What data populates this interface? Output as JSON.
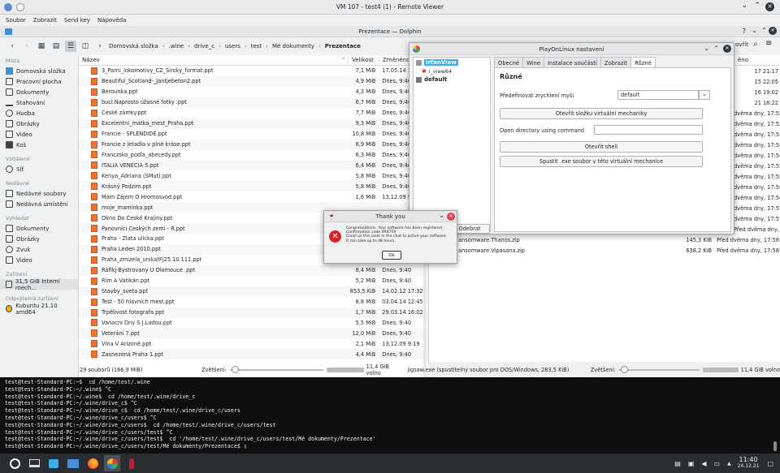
{
  "remote_viewer": {
    "title": "VM 107 - test4 (1) - Remote Viewer",
    "menu": [
      "Soubor",
      "Zobrazit",
      "Send key",
      "Nápověda"
    ]
  },
  "dolphin": {
    "title": "Prezentace — Dolphin",
    "breadcrumbs": [
      "Domovská složka",
      ".wine",
      "drive_c",
      "users",
      "test",
      "Mé dokumenty",
      "Prezentace"
    ],
    "sidebar": {
      "places_title": "Místa",
      "places": [
        "Domovská složka",
        "Pracovní plocha",
        "Dokumenty",
        "Stahování",
        "Hudba",
        "Obrázky",
        "Video",
        "Koš"
      ],
      "remote_title": "Vzdálené",
      "remote": [
        "Síť"
      ],
      "recent_title": "Nedávné",
      "recent": [
        "Nedávné soubory",
        "Nedávná umístění"
      ],
      "search_title": "Vyhledat",
      "search": [
        "Dokumenty",
        "Obrázky",
        "Zvuk",
        "Video"
      ],
      "devices_title": "Zařízení",
      "devices": [
        "31,5 GiB Interní mech..."
      ],
      "removable_title": "Odpojitelná zařízení",
      "removable": [
        "Kubuntu 21.10 amd64"
      ]
    },
    "columns": {
      "name": "Název",
      "size": "Velikost",
      "modified": "Změněno"
    },
    "files": [
      {
        "name": "3_Parni_lokomotivy_CZ_Siroky_format.ppt",
        "size": "7,1 MiB",
        "date": "17.05.14 17:21"
      },
      {
        "name": "Beautiful_Scotland-_Jantjebeton2.ppt",
        "size": "4,9 MiB",
        "date": "Dnes, 9:40"
      },
      {
        "name": "Berounka.ppt",
        "size": "4,3 MiB",
        "date": "Dnes, 9:40"
      },
      {
        "name": "bucl.Naprosto úžasné fotky .ppt",
        "size": "6,7 MiB",
        "date": "Dnes, 9:40"
      },
      {
        "name": "Ceské zámky.ppt",
        "size": "7,7 MiB",
        "date": "Dnes, 9:40"
      },
      {
        "name": "Excelentni_matka_mest_Praha.ppt",
        "size": "9,3 MiB",
        "date": "Dnes, 9:40"
      },
      {
        "name": "Francie - SPLENDIDE.ppt",
        "size": "10,8 MiB",
        "date": "Dnes, 9:40"
      },
      {
        "name": "Francie z letadla v plné kráse.ppt",
        "size": "6,9 MiB",
        "date": "Dnes, 9:40"
      },
      {
        "name": "Franczsko_podla_abecedy.ppt",
        "size": "6,3 MiB",
        "date": "Dnes, 9:40"
      },
      {
        "name": "ITALIA VENECIA 5.ppt",
        "size": "6,4 MiB",
        "date": "Dnes, 9:40"
      },
      {
        "name": "Kenya_Adriana (SMut).ppt",
        "size": "5,8 MiB",
        "date": "Dnes, 9:40"
      },
      {
        "name": "Krásný Podzim.ppt",
        "size": "5,8 MiB",
        "date": "Dnes, 9:40"
      },
      {
        "name": "Mám Zájem O Hromosvod.ppt",
        "size": "1,6 MiB",
        "date": "13.12.09 9:19"
      },
      {
        "name": "moje_maminka.ppt",
        "size": "",
        "date": ""
      },
      {
        "name": "Okno Do České Krajiny.ppt",
        "size": "",
        "date": ""
      },
      {
        "name": "Panovníci Ceských zemi - R.ppt",
        "size": "",
        "date": ""
      },
      {
        "name": "Praha - Zlata ulicka.ppt",
        "size": "",
        "date": ""
      },
      {
        "name": "Praha Leden 2010.ppt",
        "size": "",
        "date": ""
      },
      {
        "name": "Praha_zmizela_unikatFj25.10.111.ppt",
        "size": "",
        "date": ""
      },
      {
        "name": "Ráflkj-Bystrovany U Olomouce .ppt",
        "size": "8,4 MiB",
        "date": "Dnes, 9:40"
      },
      {
        "name": "Řím A Vatikán.ppt",
        "size": "5,2 MiB",
        "date": "Dnes, 9:40"
      },
      {
        "name": "Stavby_sveta.ppt",
        "size": "853,5 KiB",
        "date": "14.02.12 17:32"
      },
      {
        "name": "Test - 50 hlavních mest.ppt",
        "size": "8,8 MiB",
        "date": "03.04.14 12:45"
      },
      {
        "name": "Trpělivost fotografa.ppt",
        "size": "1,7 MiB",
        "date": "29.03.14 16:02"
      },
      {
        "name": "Vanocni Dny S J.Ladou.ppt",
        "size": "5,5 MiB",
        "date": "Dnes, 9:40"
      },
      {
        "name": "Veterání 7.ppt",
        "size": "12,0 MiB",
        "date": "Dnes, 9:40"
      },
      {
        "name": "Vlna V Arizoně.ppt",
        "size": "2,1 MiB",
        "date": "13.12.09 9:19"
      },
      {
        "name": "Zasnezená Praha 1.ppt",
        "size": "4,4 MiB",
        "date": "Dnes, 9:40"
      }
    ],
    "right_pane": {
      "col_date": "ěno",
      "top_dates": [
        "17 21:17",
        "15 22:05",
        "16 19:02",
        "21 18:22",
        "dvěma dny, 17:53",
        "dvěma dny, 17:53",
        "dvěma dny, 17:54",
        "dvěma dny, 17:54",
        "dvěma dny, 17:54",
        "dvěma dny, 17:55",
        "dvěma dny, 17:55",
        "dvěma dny, 17:56",
        "dvěma dny, 17:56",
        "dvěma dny, 17:57",
        "dvěma dny, 17:57",
        "Před dvěma dny, 17:58"
      ],
      "files": [
        {
          "name": "ansomware.Thanos.zip",
          "size": "145,3 KiB",
          "date": "Před dvěma dny, 17:58"
        },
        {
          "name": "ansomware.Vipasana.zip",
          "size": "638,2 KiB",
          "date": "Před dvěma dny, 17:58"
        }
      ]
    },
    "status_left": {
      "count": "29 souborů (166,9 MiB)",
      "zoom_label": "Zvětšení:",
      "free": "11,4 GiB volno"
    },
    "status_mid": "jigsaw.exe (spustitelný soubor pro DOS/Windows, 283,5 KiB)",
    "status_right": {
      "zoom_label": "Zvětšení:",
      "free": "11,4 GiB volno"
    }
  },
  "pol": {
    "title": "PlayOnLinux nastavení",
    "list": [
      "IrfanView",
      "i_view64",
      "default"
    ],
    "tabs": [
      "Obecné",
      "Wine",
      "Instalace součástí",
      "Zobrazit",
      "Různé"
    ],
    "heading": "Různé",
    "mouse_label": "Předefinovat zrychlení myši",
    "mouse_value": "default",
    "btn_open_folder": "Otevřít složku virtuální mechaniky",
    "open_dir_label": "Open directory using command",
    "btn_shell": "Otevřít shell",
    "btn_exe": "Spustit .exe soubor v této virtuální mechanice",
    "btn_remove": "Odebrat"
  },
  "thank_you": {
    "title": "Thank you",
    "lines": [
      "Congratulations. Your software has been registered.",
      "Confirmation code 994759",
      "Email us this code in the chat to active your software.",
      "It can take up to 48 hours."
    ],
    "ok": "Ok"
  },
  "terminal": [
    "test@test-Standard-PC:~$  cd /home/test/.wine",
    "test@test-Standard-PC:~/.wine$ ^C",
    "test@test-Standard-PC:~/.wine$  cd /home/test/.wine/drive_c",
    "test@test-Standard-PC:~/.wine/drive_c$ ^C",
    "test@test-Standard-PC:~/.wine/drive_c$  cd /home/test/.wine/drive_c/users",
    "test@test-Standard-PC:~/.wine/drive_c/users$ ^C",
    "test@test-Standard-PC:~/.wine/drive_c/users$  cd /home/test/.wine/drive_c/users/test",
    "test@test-Standard-PC:~/.wine/drive_c/users/test$ ^C",
    "test@test-Standard-PC:~/.wine/drive_c/users/test$  cd '/home/test/.wine/drive_c/users/test/Mé dokumenty/Prezentace'",
    "test@test-Standard-PC:~/.wine/drive_c/users/test/Mé dokumenty/Prezentace$ ▯"
  ],
  "taskbar": {
    "time": "11:40",
    "date": "24.12.21"
  }
}
